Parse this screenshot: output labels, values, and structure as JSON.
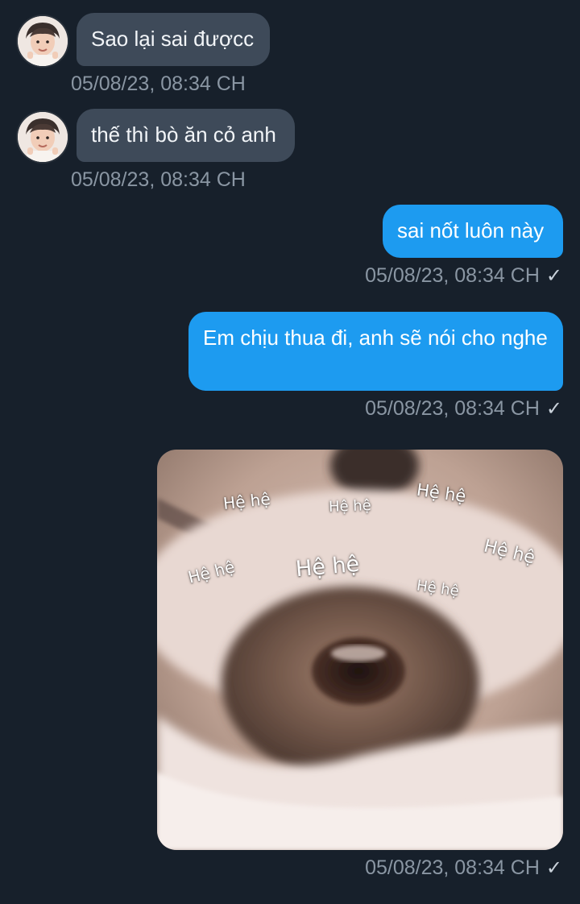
{
  "messages": [
    {
      "text": "Sao lại sai đượcc",
      "time": "05/08/23, 08:34 CH"
    },
    {
      "text": "thế thì bò ăn cỏ anh",
      "time": "05/08/23, 08:34 CH"
    },
    {
      "text": "sai nốt luôn này",
      "time": "05/08/23, 08:34 CH",
      "status": "✓"
    },
    {
      "text": "Em chịu thua đi, anh sẽ nói cho nghe",
      "time": "05/08/23, 08:34 CH",
      "status": "✓"
    },
    {
      "time": "05/08/23, 08:34 CH",
      "status": "✓"
    }
  ],
  "image_captions": [
    "Hệ hệ",
    "Hệ hệ",
    "Hệ hệ",
    "Hệ hệ",
    "Hệ hệ",
    "Hệ hệ",
    "Hệ hệ"
  ],
  "colors": {
    "background": "#17202b",
    "incoming_bubble": "#3e4a59",
    "outgoing_bubble": "#1d9bf0",
    "timestamp": "#8a96a3"
  }
}
